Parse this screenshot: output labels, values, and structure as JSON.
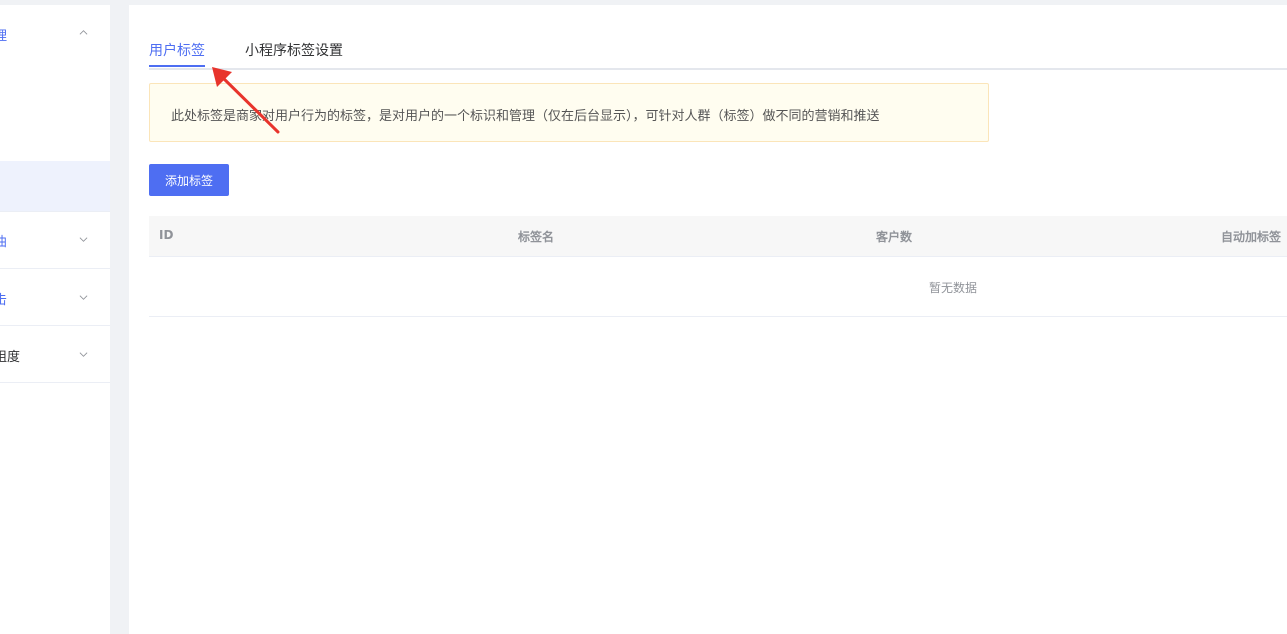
{
  "sidebar": {
    "groups": [
      {
        "label": "理",
        "expanded": true,
        "active": true
      },
      {
        "label": "曲",
        "expanded": false,
        "active": true
      },
      {
        "label": "击",
        "expanded": false,
        "active": true
      },
      {
        "label": "阻度",
        "expanded": false,
        "active": false
      }
    ]
  },
  "tabs": {
    "user_tags": "用户标签",
    "miniprogram_settings": "小程序标签设置"
  },
  "notice": {
    "text": "此处标签是商家对用户行为的标签，是对用户的一个标识和管理（仅在后台显示），可针对人群（标签）做不同的营销和推送"
  },
  "toolbar": {
    "add_label": "添加标签"
  },
  "table": {
    "columns": [
      "ID",
      "标签名",
      "客户数",
      "自动加标签"
    ],
    "empty_text": "暂无数据"
  },
  "colors": {
    "accent": "#4e6ef2",
    "notice_bg": "#fffdf0",
    "arrow": "#e8342c"
  }
}
